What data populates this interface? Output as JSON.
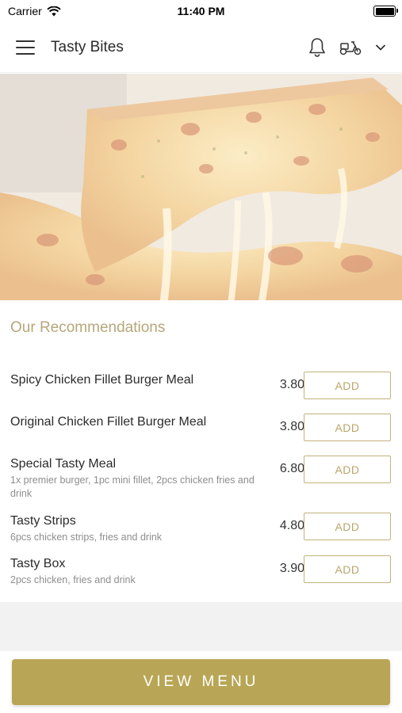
{
  "status_bar": {
    "carrier": "Carrier",
    "time": "11:40 PM"
  },
  "header": {
    "title": "Tasty Bites",
    "icons": [
      "menu-icon",
      "bell-icon",
      "scooter-icon",
      "chevron-down-icon"
    ]
  },
  "hero": {
    "image": "cheese-pizza-slice"
  },
  "recommendations": {
    "title": "Our Recommendations",
    "add_label": "ADD",
    "items": [
      {
        "name": "Spicy Chicken Fillet Burger Meal",
        "desc": "",
        "price": "3.80"
      },
      {
        "name": "Original Chicken Fillet Burger Meal",
        "desc": "",
        "price": "3.80"
      },
      {
        "name": "Special Tasty Meal",
        "desc": "1x premier burger, 1pc mini fillet, 2pcs chicken fries and drink",
        "price": "6.80"
      },
      {
        "name": "Tasty Strips",
        "desc": "6pcs chicken strips, fries and drink",
        "price": "4.80"
      },
      {
        "name": "Tasty Box",
        "desc": "2pcs chicken, fries and drink",
        "price": "3.90"
      }
    ]
  },
  "footer": {
    "view_menu_label": "VIEW MENU"
  },
  "colors": {
    "accent": "#b8a656",
    "section_title": "#b6a77a",
    "button_border": "#c2b37d"
  }
}
